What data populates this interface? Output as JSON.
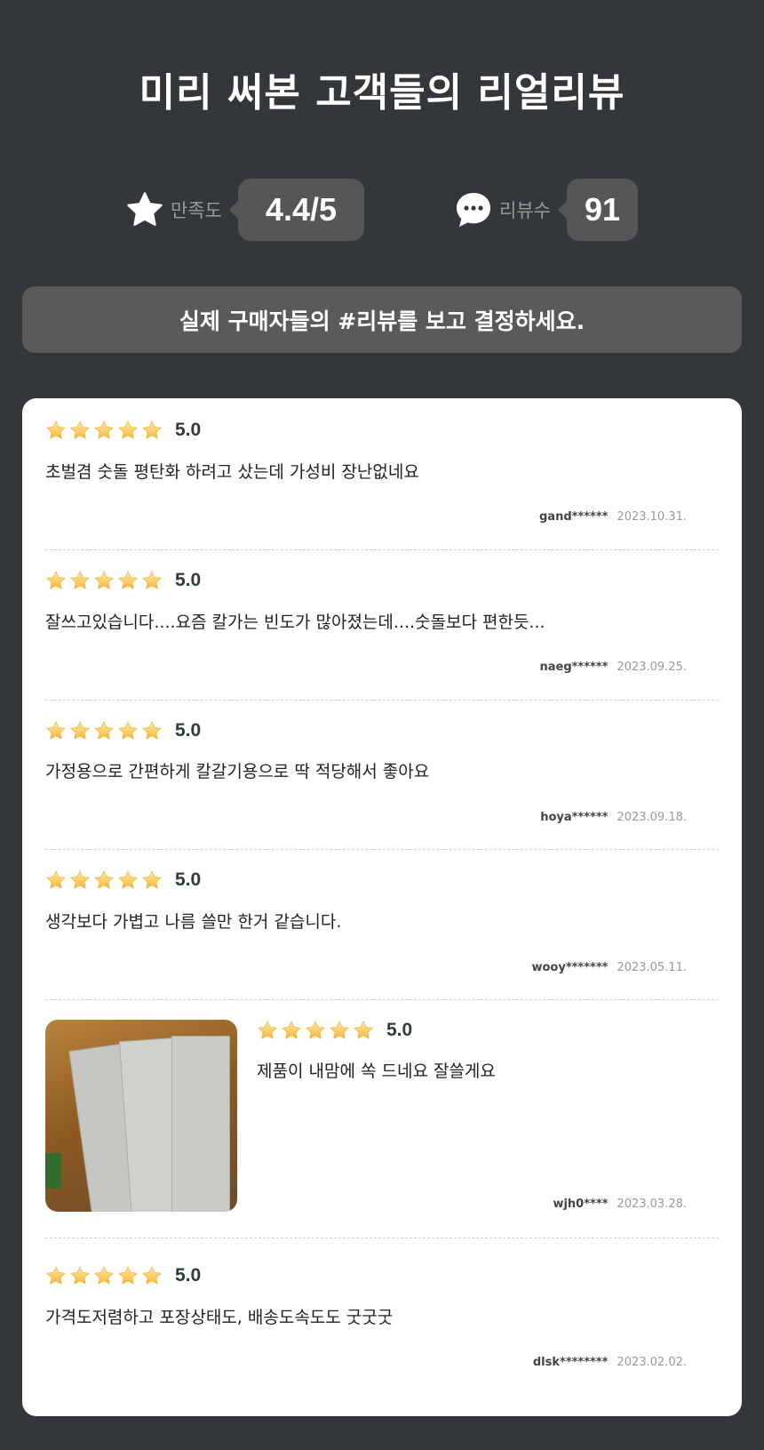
{
  "header": {
    "title": "미리 써본 고객들의 리얼리뷰"
  },
  "stats": {
    "satisfaction": {
      "icon": "star-icon",
      "label": "만족도",
      "value": "4.4/5"
    },
    "reviews": {
      "icon": "chat-bubble-icon",
      "label": "리뷰수",
      "value": "91"
    }
  },
  "banner": {
    "text": "실제 구매자들의 #리뷰를 보고 결정하세요."
  },
  "colors": {
    "background": "#343739",
    "card": "#ffffff",
    "star": "#f8c34a",
    "score": "#2f3d3a"
  },
  "reviews": [
    {
      "score": "5.0",
      "stars": 5,
      "text": "초벌겸 숫돌 평탄화 하려고 샀는데 가성비 장난없네요",
      "author": "gand******",
      "date": "2023.10.31."
    },
    {
      "score": "5.0",
      "stars": 5,
      "text": "잘쓰고있습니다....요즘 칼가는 빈도가 많아졌는데....숫돌보다 편한듯...",
      "author": "naeg******",
      "date": "2023.09.25."
    },
    {
      "score": "5.0",
      "stars": 5,
      "text": "가정용으로 간편하게 칼갈기용으로 딱 적당해서 좋아요",
      "author": "hoya******",
      "date": "2023.09.18."
    },
    {
      "score": "5.0",
      "stars": 5,
      "text": "생각보다 가볍고 나름 쓸만 한거 같습니다.",
      "author": "wooy*******",
      "date": "2023.05.11."
    },
    {
      "score": "5.0",
      "stars": 5,
      "text": "제품이 내맘에 쏙 드네요 잘쓸게요",
      "author": "wjh0****",
      "date": "2023.03.28.",
      "photo": "review-photo"
    },
    {
      "score": "5.0",
      "stars": 5,
      "text": "가격도저렴하고 포장상태도, 배송도속도도 굿굿굿",
      "author": "dlsk********",
      "date": "2023.02.02."
    }
  ]
}
